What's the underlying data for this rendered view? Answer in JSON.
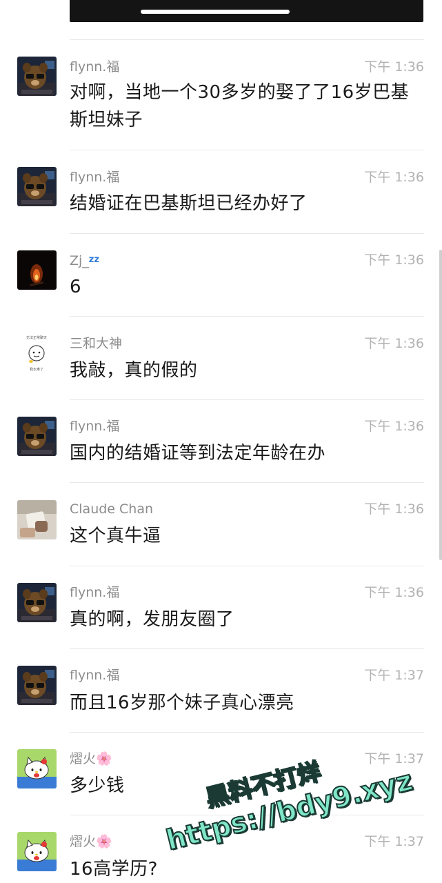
{
  "messages": [
    {
      "name": "flynn.福",
      "time": "下午 1:36",
      "text": "对啊，当地一个30多岁的娶了了16岁巴基斯坦妹子",
      "avatar": "dog-avatar"
    },
    {
      "name": "flynn.福",
      "time": "下午 1:36",
      "text": "结婚证在巴基斯坦已经办好了",
      "avatar": "dog-avatar"
    },
    {
      "name": "Zj_",
      "name_suffix": "zz",
      "time": "下午 1:36",
      "text": "6",
      "avatar": "campfire-avatar"
    },
    {
      "name": "三和大神",
      "time": "下午 1:36",
      "text": "我敲，真的假的",
      "avatar": "cartoon-meme-avatar"
    },
    {
      "name": "flynn.福",
      "time": "下午 1:36",
      "text": "国内的结婚证等到法定年龄在办",
      "avatar": "dog-avatar"
    },
    {
      "name": "Claude Chan",
      "time": "下午 1:36",
      "text": "这个真牛逼",
      "avatar": "photo-avatar"
    },
    {
      "name": "flynn.福",
      "time": "下午 1:36",
      "text": "真的啊，发朋友圈了",
      "avatar": "dog-avatar"
    },
    {
      "name": "flynn.福",
      "time": "下午 1:37",
      "text": "而且16岁那个妹子真心漂亮",
      "avatar": "dog-avatar"
    },
    {
      "name": "熠火",
      "name_suffix": "🌸",
      "time": "下午 1:37",
      "text": "多少钱",
      "avatar": "hello-kitty-avatar"
    },
    {
      "name": "熠火",
      "name_suffix": "🌸",
      "time": "下午 1:37",
      "text": "16高学历?",
      "avatar": "hello-kitty-avatar"
    }
  ],
  "avatar_text": {
    "meme_line_1": "无法正常聊天",
    "meme_line_2": "我太难了"
  },
  "watermark": {
    "line1": "黑料不打烊",
    "line2": "https://bdy9.xyz"
  },
  "colors": {
    "name": "#8c8c8c",
    "time": "#b2b2b2",
    "text": "#1a1a1a",
    "divider": "#e8e8e8",
    "watermark": "#7fe6c8"
  }
}
